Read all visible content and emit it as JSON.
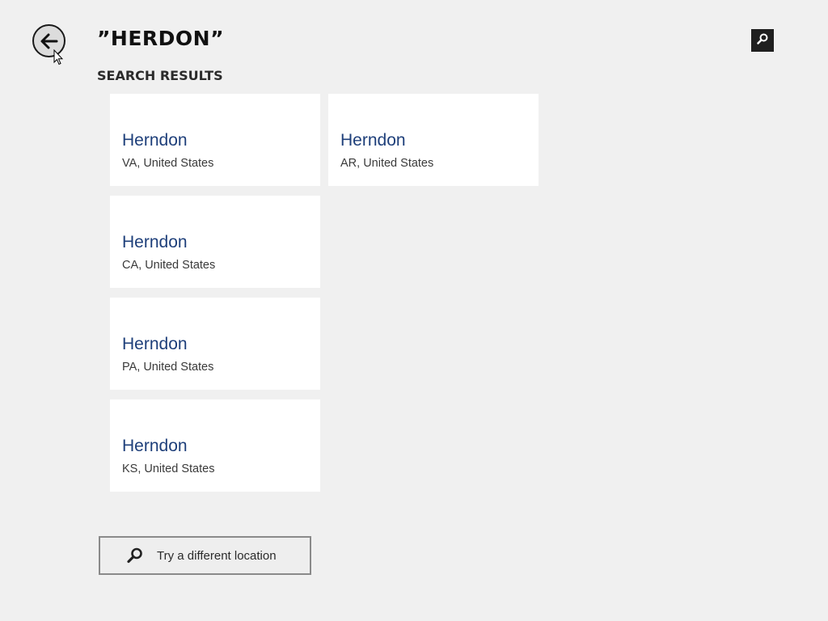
{
  "header": {
    "title": "”HERDON”",
    "back_icon": "back-arrow-icon",
    "search_icon": "search-icon"
  },
  "results": {
    "section_label": "SEARCH RESULTS",
    "items": [
      {
        "city": "Herndon",
        "region": "VA, United States"
      },
      {
        "city": "Herndon",
        "region": "AR, United States"
      },
      {
        "city": "Herndon",
        "region": "CA, United States"
      },
      {
        "city": "Herndon",
        "region": "PA, United States"
      },
      {
        "city": "Herndon",
        "region": "KS, United States"
      }
    ]
  },
  "footer": {
    "try_label": "Try a different location",
    "try_icon": "search-icon"
  },
  "colors": {
    "background": "#f0f0f0",
    "tile": "#ffffff",
    "city_text": "#1e3f7a"
  }
}
